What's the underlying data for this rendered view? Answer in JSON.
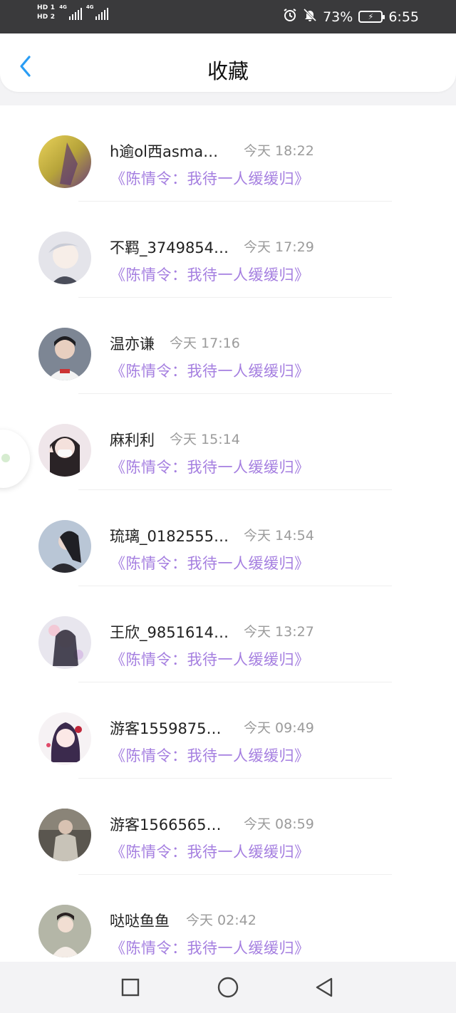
{
  "status_bar": {
    "hd1": "HD 1",
    "hd2": "HD 2",
    "net1": "4G",
    "net2": "4G",
    "battery_percent": "73%",
    "time": "6:55"
  },
  "header": {
    "title": "收藏",
    "accent_color": "#2a9df4"
  },
  "items": [
    {
      "name": "h逾ol西asma…",
      "time": "今天 18:22",
      "favorite": "《陈情令：我待一人缓缓归》"
    },
    {
      "name": "不羁_3749854…",
      "time": "今天 17:29",
      "favorite": "《陈情令：我待一人缓缓归》"
    },
    {
      "name": "温亦谦",
      "time": "今天 17:16",
      "favorite": "《陈情令：我待一人缓缓归》"
    },
    {
      "name": "麻利利",
      "time": "今天 15:14",
      "favorite": "《陈情令：我待一人缓缓归》"
    },
    {
      "name": "琉璃_0182555…",
      "time": "今天 14:54",
      "favorite": "《陈情令：我待一人缓缓归》"
    },
    {
      "name": "王欣_9851614…",
      "time": "今天 13:27",
      "favorite": "《陈情令：我待一人缓缓归》"
    },
    {
      "name": "游客1559875…",
      "time": "今天 09:49",
      "favorite": "《陈情令：我待一人缓缓归》"
    },
    {
      "name": "游客1566565…",
      "time": "今天 08:59",
      "favorite": "《陈情令：我待一人缓缓归》"
    },
    {
      "name": "哒哒鱼鱼",
      "time": "今天 02:42",
      "favorite": "《陈情令：我待一人缓缓归》"
    }
  ],
  "colors": {
    "favorite_text": "#a57fe0",
    "time_text": "#9b9b9b"
  }
}
